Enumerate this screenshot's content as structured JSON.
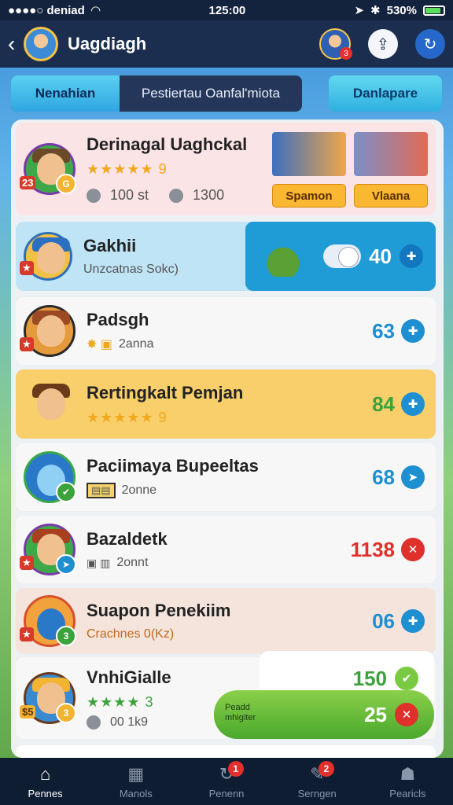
{
  "status": {
    "carrier": "●●●●○ deniad",
    "time": "125:00",
    "battery": "530%",
    "battery_level": 0.8
  },
  "header": {
    "title": "Uagdiagh",
    "badge": "3"
  },
  "tabs": {
    "active": "Nenahian",
    "inactive": "Pestiertau Oanfal'miota",
    "side": "Danlapare"
  },
  "featured": {
    "name": "Derinagal Uaghckal",
    "rating": "★★★★★ 9",
    "coins1": "100 st",
    "coins2": "1300",
    "rank": "23",
    "btn1": "Spamon",
    "btn2": "Vlaana"
  },
  "rows": [
    {
      "name": "Gakhii",
      "sub": "Unzcatnas Sokc)",
      "score": "40",
      "score_color": "#ffffff",
      "icon": "✚"
    },
    {
      "name": "Padsgh",
      "sub": "2anna",
      "score": "63",
      "score_color": "#1e8fd0",
      "icon": "✚"
    },
    {
      "name": "Rertingkalt Pemjan",
      "sub": "★★★★★ 9",
      "score": "84",
      "score_color": "#3ca23c",
      "icon": "✚"
    },
    {
      "name": "Paciimaya Bupeeltas",
      "sub": "2onne",
      "score": "68",
      "score_color": "#1e8fd0",
      "icon": "➤"
    },
    {
      "name": "Bazaldetk",
      "sub": "2onnt",
      "score": "1138",
      "score_color": "#e0302c",
      "icon": "✕"
    },
    {
      "name": "Suapon Penekiim",
      "sub": "Crachnes 0(Kz)",
      "score": "06",
      "score_color": "#1e8fd0",
      "icon": "✚"
    },
    {
      "name": "VnhiGialle",
      "sub": "00 1k9",
      "score": "150",
      "score_color": "#3ca23c",
      "icon": "✔"
    }
  ],
  "reward": {
    "label": "Peadd mhigiter",
    "value": "25"
  },
  "nav": [
    "Pennes",
    "Manols",
    "Penenn",
    "Serngen",
    "Pearicls"
  ],
  "nav_badges": [
    "1",
    "2"
  ]
}
